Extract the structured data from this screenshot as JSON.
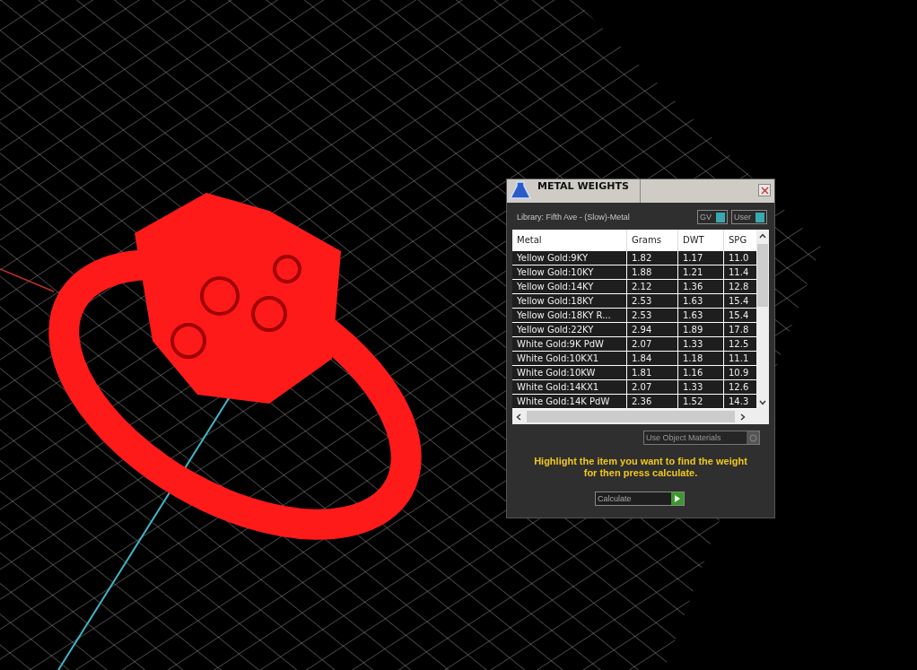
{
  "dialog": {
    "title": "METAL WEIGHTS",
    "library": "Library: Fifth Ave - (Slow)-Metal",
    "toggles": [
      {
        "label": "GV",
        "on": true
      },
      {
        "label": "User",
        "on": true
      }
    ],
    "table": {
      "columns": [
        "Metal",
        "Grams",
        "DWT",
        "SPG"
      ],
      "rows": [
        {
          "metal": "Yellow Gold:9KY",
          "grams": "1.82",
          "dwt": "1.17",
          "spg": "11.0"
        },
        {
          "metal": "Yellow Gold:10KY",
          "grams": "1.88",
          "dwt": "1.21",
          "spg": "11.4"
        },
        {
          "metal": "Yellow Gold:14KY",
          "grams": "2.12",
          "dwt": "1.36",
          "spg": "12.8"
        },
        {
          "metal": "Yellow Gold:18KY",
          "grams": "2.53",
          "dwt": "1.63",
          "spg": "15.4"
        },
        {
          "metal": "Yellow Gold:18KY R...",
          "grams": "2.53",
          "dwt": "1.63",
          "spg": "15.4"
        },
        {
          "metal": "Yellow Gold:22KY",
          "grams": "2.94",
          "dwt": "1.89",
          "spg": "17.8"
        },
        {
          "metal": "White Gold:9K PdW",
          "grams": "2.07",
          "dwt": "1.33",
          "spg": "12.5"
        },
        {
          "metal": "White Gold:10KX1",
          "grams": "1.84",
          "dwt": "1.18",
          "spg": "11.1"
        },
        {
          "metal": "White Gold:10KW",
          "grams": "1.81",
          "dwt": "1.16",
          "spg": "10.9"
        },
        {
          "metal": "White Gold:14KX1",
          "grams": "2.07",
          "dwt": "1.33",
          "spg": "12.6"
        },
        {
          "metal": "White Gold:14K PdW",
          "grams": "2.36",
          "dwt": "1.52",
          "spg": "14.3"
        }
      ]
    },
    "use_object_materials": "Use Object Materials",
    "hint": "Highlight the item you want to find the weight for then press calculate.",
    "calculate_button": "Calculate"
  }
}
